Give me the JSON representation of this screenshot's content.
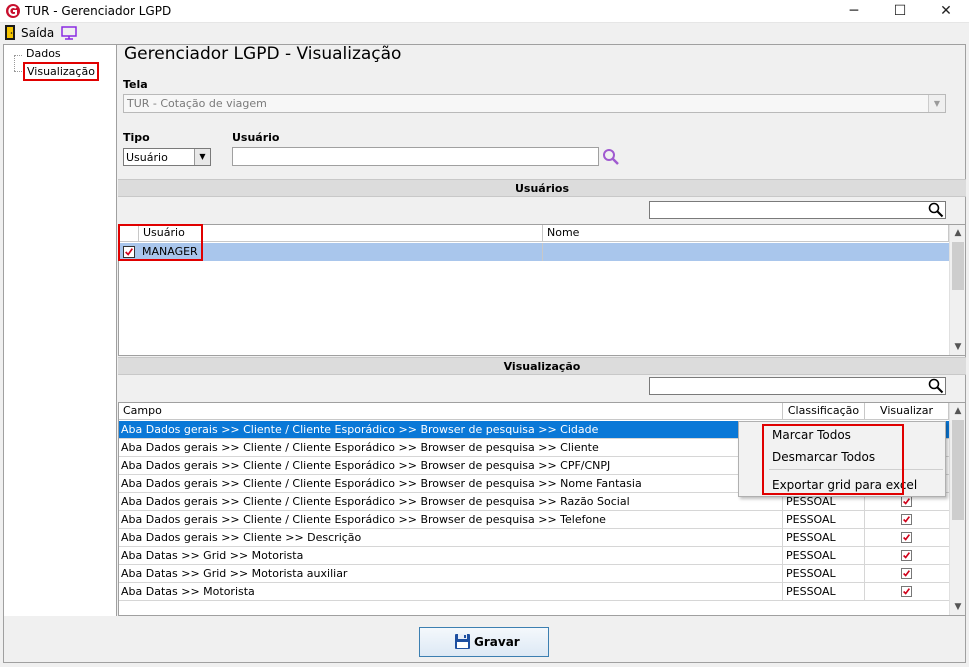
{
  "window": {
    "title": "TUR - Gerenciador LGPD",
    "minimize": "─",
    "maximize": "☐",
    "close": "✕"
  },
  "toolbar": {
    "exit_label": "Saída",
    "exit_icon": "exit-door-icon",
    "monitor_icon": "monitor-icon"
  },
  "tree": {
    "items": [
      {
        "label": "Dados"
      },
      {
        "label": "Visualização"
      }
    ]
  },
  "page": {
    "title": "Gerenciador LGPD - Visualização"
  },
  "form": {
    "tela_label": "Tela",
    "tela_value": "TUR - Cotação de viagem",
    "tipo_label": "Tipo",
    "tipo_value": "Usuário",
    "usuario_label": "Usuário",
    "usuario_value": ""
  },
  "usuarios": {
    "header": "Usuários",
    "search_value": "",
    "columns": [
      "Usuário",
      "Nome"
    ],
    "rows": [
      {
        "checked": true,
        "usuario": "MANAGER",
        "nome": ""
      }
    ]
  },
  "visualizacao": {
    "header": "Visualização",
    "search_value": "",
    "columns": [
      "Campo",
      "Classificação",
      "Visualizar"
    ],
    "rows": [
      {
        "campo": "Aba Dados gerais >> Cliente / Cliente Esporádico >> Browser de pesquisa >> Cidade",
        "classificacao": "",
        "visualizar": true
      },
      {
        "campo": "Aba Dados gerais >> Cliente / Cliente Esporádico >> Browser de pesquisa >> Cliente",
        "classificacao": "",
        "visualizar": true
      },
      {
        "campo": "Aba Dados gerais >> Cliente / Cliente Esporádico >> Browser de pesquisa >> CPF/CNPJ",
        "classificacao": "",
        "visualizar": true
      },
      {
        "campo": "Aba Dados gerais >> Cliente / Cliente Esporádico >> Browser de pesquisa >> Nome Fantasia",
        "classificacao": "",
        "visualizar": true
      },
      {
        "campo": "Aba Dados gerais >> Cliente / Cliente Esporádico >> Browser de pesquisa >> Razão Social",
        "classificacao": "PESSOAL",
        "visualizar": true
      },
      {
        "campo": "Aba Dados gerais >> Cliente / Cliente Esporádico >> Browser de pesquisa >> Telefone",
        "classificacao": "PESSOAL",
        "visualizar": true
      },
      {
        "campo": "Aba Dados gerais >> Cliente >> Descrição",
        "classificacao": "PESSOAL",
        "visualizar": true
      },
      {
        "campo": "Aba Datas >> Grid >> Motorista",
        "classificacao": "PESSOAL",
        "visualizar": true
      },
      {
        "campo": "Aba Datas >> Grid >> Motorista auxiliar",
        "classificacao": "PESSOAL",
        "visualizar": true
      },
      {
        "campo": "Aba Datas >> Motorista",
        "classificacao": "PESSOAL",
        "visualizar": true
      }
    ]
  },
  "context_menu": {
    "items": [
      "Marcar Todos",
      "Desmarcar Todos",
      "Exportar grid para excel"
    ]
  },
  "footer": {
    "save_label": "Gravar"
  },
  "colors": {
    "selection_blue": "#0a78d7",
    "user_row_blue": "#a9c6ec",
    "highlight_red": "#e00000",
    "check_red": "#d0021b",
    "search_purple": "#a05ad0"
  }
}
